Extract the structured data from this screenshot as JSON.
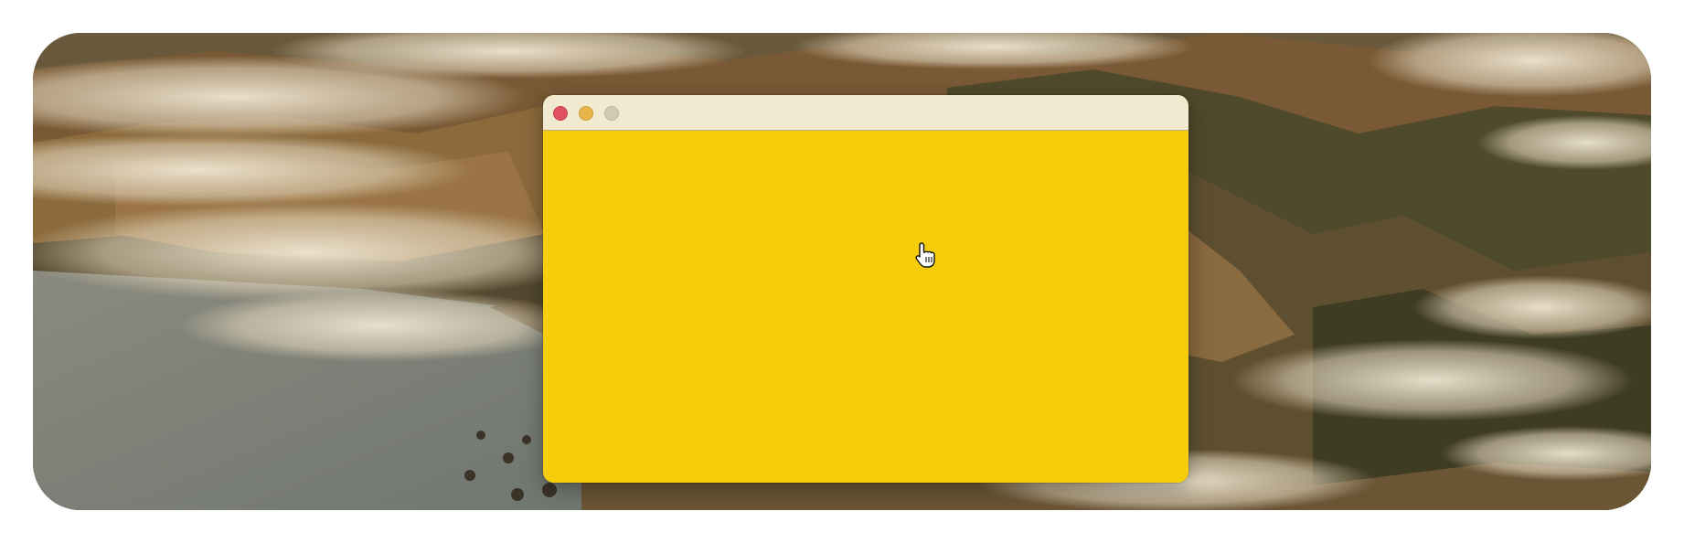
{
  "desktop": {
    "wallpaper": "coastal-mountains-with-fog"
  },
  "window": {
    "title": "",
    "titlebar_color": "#f2ead0",
    "content_color": "#f6cd0a",
    "controls": {
      "close": {
        "color": "#e0505f",
        "icon": "close-icon"
      },
      "minimize": {
        "color": "#e7b64b",
        "icon": "minimize-icon"
      },
      "maximize": {
        "color": "#cfcbb5",
        "icon": "maximize-icon",
        "state": "disabled"
      }
    }
  },
  "cursor": {
    "type": "pointing-hand"
  }
}
